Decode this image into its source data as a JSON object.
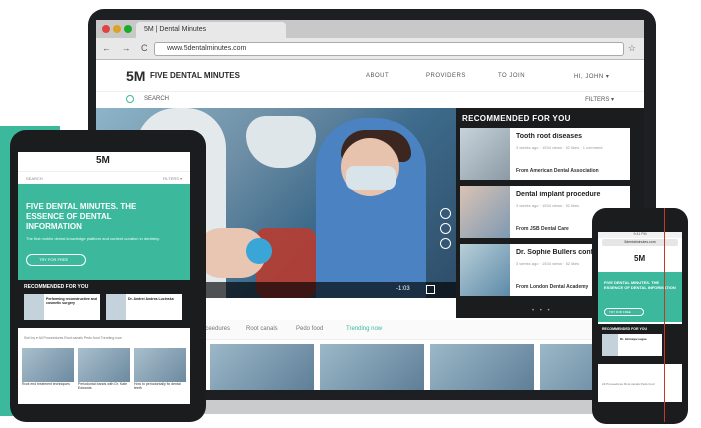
{
  "browser": {
    "tab_title": "5M | Dental Minutes",
    "url": "www.5dentalminutes.com",
    "nav_icons": "← → C ⌂",
    "star": "☆"
  },
  "site": {
    "logo_mark": "5M",
    "logo_text": "FIVE DENTAL MINUTES",
    "nav": [
      "ABOUT",
      "PROVIDERS",
      "TO JOIN",
      "HI, JOHN ▾"
    ],
    "search_label": "SEARCH",
    "filters_label": "FILTERS ▾"
  },
  "hero": {
    "time": "-1:03"
  },
  "recommended": {
    "title": "RECOMMENDED FOR YOU",
    "items": [
      {
        "title": "Tooth root diseases",
        "meta": "3 weeks ago · 1534 views · 52 likes · 1 comment",
        "from": "From American Dental Association"
      },
      {
        "title": "Dental implant procedure",
        "meta": "3 weeks ago · 1534 views · 52 likes",
        "from": "From JSB Dental Care"
      },
      {
        "title": "Dr. Sophie Bullers conf",
        "meta": "3 weeks ago · 1534 views · 52 likes",
        "from": "From London Dental Academy"
      }
    ],
    "dots": "• • •"
  },
  "subnav": [
    "Proceedures",
    "Root canals",
    "Pedo food",
    "Trending now"
  ],
  "tablet": {
    "logo_mark": "5M",
    "search": "SEARCH",
    "filters": "FILTERS ▾",
    "hero_title": "FIVE DENTAL MINUTES. THE ESSENCE OF DENTAL INFORMATION",
    "hero_sub": "The first mobile dental knowledge platform and content curation in dentistry.",
    "cta": "TRY FOR FREE",
    "rec_title": "RECOMMENDED FOR YOU",
    "rec_items": [
      "Performing reconstructive and cosmetic surgery",
      "Dr. Andrei Andrea Lucinska"
    ],
    "tabs": "Sort by ▾   All   Proceedures   Root canals   Pedo food   Trending now",
    "grid_labels": [
      "Root end treatment techniques",
      "Periodontal bands with Dr. Kate Edwards",
      "How to periodontally fix dental teeth"
    ]
  },
  "phone": {
    "status": "9:41 PM",
    "url": "5dentalminutes.com",
    "logo_mark": "5M",
    "hero_title": "FIVE DENTAL MINUTES. THE ESSENCE OF DENTAL INFORMATION",
    "cta": "TRY FOR FREE",
    "rec_title": "RECOMMENDED FOR YOU",
    "rec_item": "Dr. Ishmaya Lugue",
    "tabs": "All   Proceedures   Root canals   Pedo food"
  },
  "colors": {
    "accent": "#3cb99c",
    "dark": "#1b1c1e"
  }
}
